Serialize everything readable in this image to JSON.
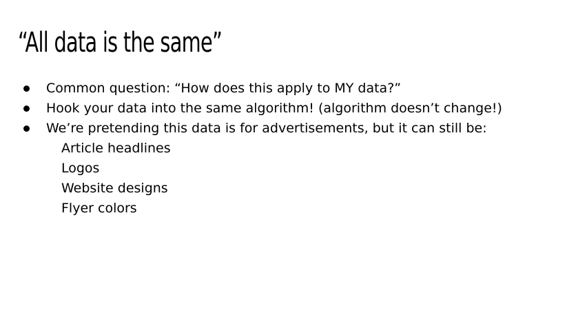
{
  "slide": {
    "title": "“All data is the same”",
    "bullets": [
      {
        "text": "Common question: “How does this apply to MY data?”"
      },
      {
        "text": "Hook your data into the same algorithm! (algorithm doesn’t change!)"
      },
      {
        "text": "We’re pretending this data is for advertisements, but it can still be:"
      }
    ],
    "sub_items": [
      "Article headlines",
      "Logos",
      "Website designs",
      "Flyer colors"
    ]
  },
  "colors": {
    "background": "#ffffff",
    "text": "#000000"
  }
}
